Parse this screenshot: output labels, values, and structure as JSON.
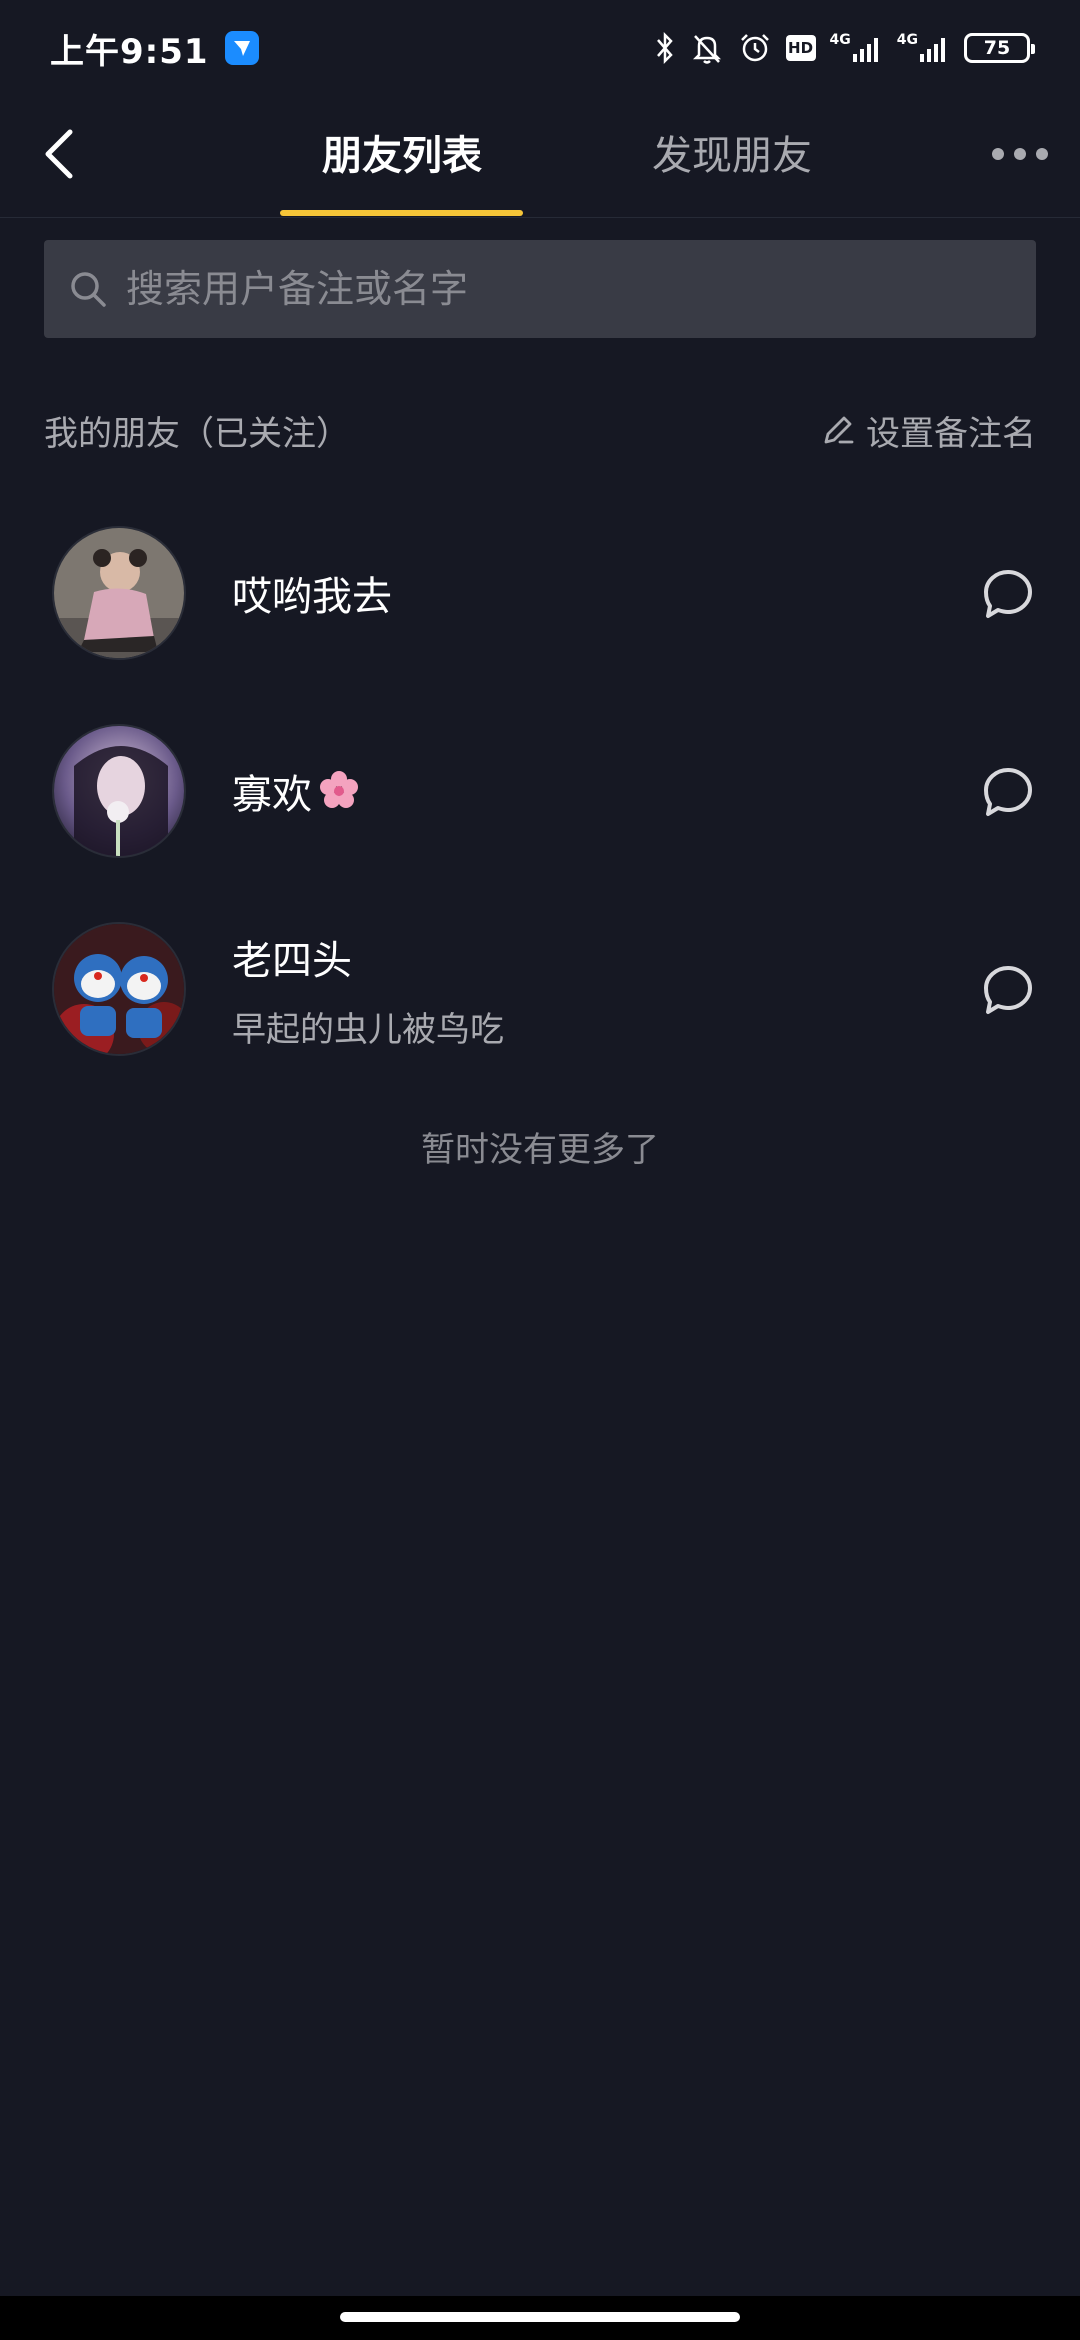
{
  "status_bar": {
    "time": "上午9:51",
    "hd_label": "HD",
    "network_1": "4G",
    "network_2": "4G",
    "battery": "75"
  },
  "nav": {
    "tab_friends": "朋友列表",
    "tab_discover": "发现朋友"
  },
  "search": {
    "placeholder": "搜索用户备注或名字"
  },
  "section": {
    "title": "我的朋友（已关注）",
    "remark_button": "设置备注名"
  },
  "friends": [
    {
      "name": "哎哟我去",
      "subtitle": ""
    },
    {
      "name": "寡欢",
      "subtitle": ""
    },
    {
      "name": "老四头",
      "subtitle": "早起的虫儿被鸟吃"
    }
  ],
  "footer_text": "暂时没有更多了",
  "colors": {
    "background": "#161823",
    "accent": "#f6c538",
    "search_bg": "#393b45",
    "muted_text": "#a9aab0"
  }
}
